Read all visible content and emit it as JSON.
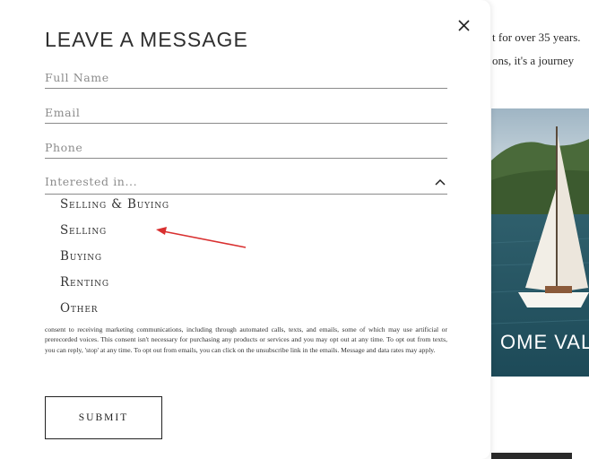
{
  "background": {
    "text_line_1": "t for over 35 years.",
    "text_line_2": "ons, it's a journey",
    "overlay_text": "OME VAL"
  },
  "modal": {
    "title": "LEAVE A MESSAGE",
    "close_icon": "close-icon",
    "fields": {
      "full_name_placeholder": "Full Name",
      "email_placeholder": "Email",
      "phone_placeholder": "Phone"
    },
    "interested": {
      "placeholder": "Interested in...",
      "chevron_icon": "chevron-up-icon",
      "options": [
        "Selling & Buying",
        "Selling",
        "Buying",
        "Renting",
        "Other"
      ]
    },
    "consent_text": "consent to receiving marketing communications, including through automated calls, texts, and emails, some of which may use artificial or prerecorded voices. This consent isn't necessary for purchasing any products or services and you may opt out at any time. To opt out from texts, you can reply, 'stop' at any time. To opt out from emails, you can click on the unsubscribe link in the emails. Message and data rates may apply.",
    "submit_label": "SUBMIT"
  },
  "annotation": {
    "arrow_color": "#d93030"
  }
}
